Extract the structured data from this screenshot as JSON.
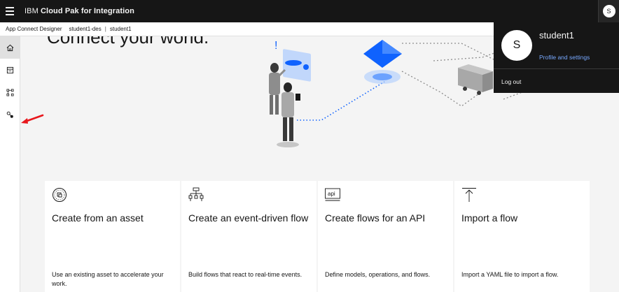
{
  "header": {
    "brand_prefix": "IBM",
    "brand_name": "Cloud Pak for Integration",
    "user_initial": "S"
  },
  "breadcrumb": {
    "app": "App Connect Designer",
    "instance": "student1-des",
    "separator": "|",
    "user": "student1"
  },
  "sidebar": {
    "items": [
      {
        "name": "home-icon",
        "active": true
      },
      {
        "name": "catalog-icon",
        "active": false
      },
      {
        "name": "flows-icon",
        "active": false
      },
      {
        "name": "connections-icon",
        "active": false
      }
    ]
  },
  "main": {
    "hero_title": "Connect your world."
  },
  "cards": [
    {
      "title": "Create from an asset",
      "desc": "Use an existing asset to accelerate your work.",
      "icon": "asset-icon"
    },
    {
      "title": "Create an event-driven flow",
      "desc": "Build flows that react to real-time events.",
      "icon": "event-flow-icon"
    },
    {
      "title": "Create flows for an API",
      "desc": "Define models, operations, and flows.",
      "icon": "api-icon",
      "icon_text": "api"
    },
    {
      "title": "Import a flow",
      "desc": "Import a YAML file to import a flow.",
      "icon": "import-icon"
    }
  ],
  "profile": {
    "initial": "S",
    "username": "student1",
    "profile_link": "Profile and settings",
    "logout": "Log out"
  },
  "colors": {
    "header_bg": "#161616",
    "link": "#78a9ff",
    "accent_blue": "#0f62fe",
    "annotation_red": "#e8171c"
  }
}
